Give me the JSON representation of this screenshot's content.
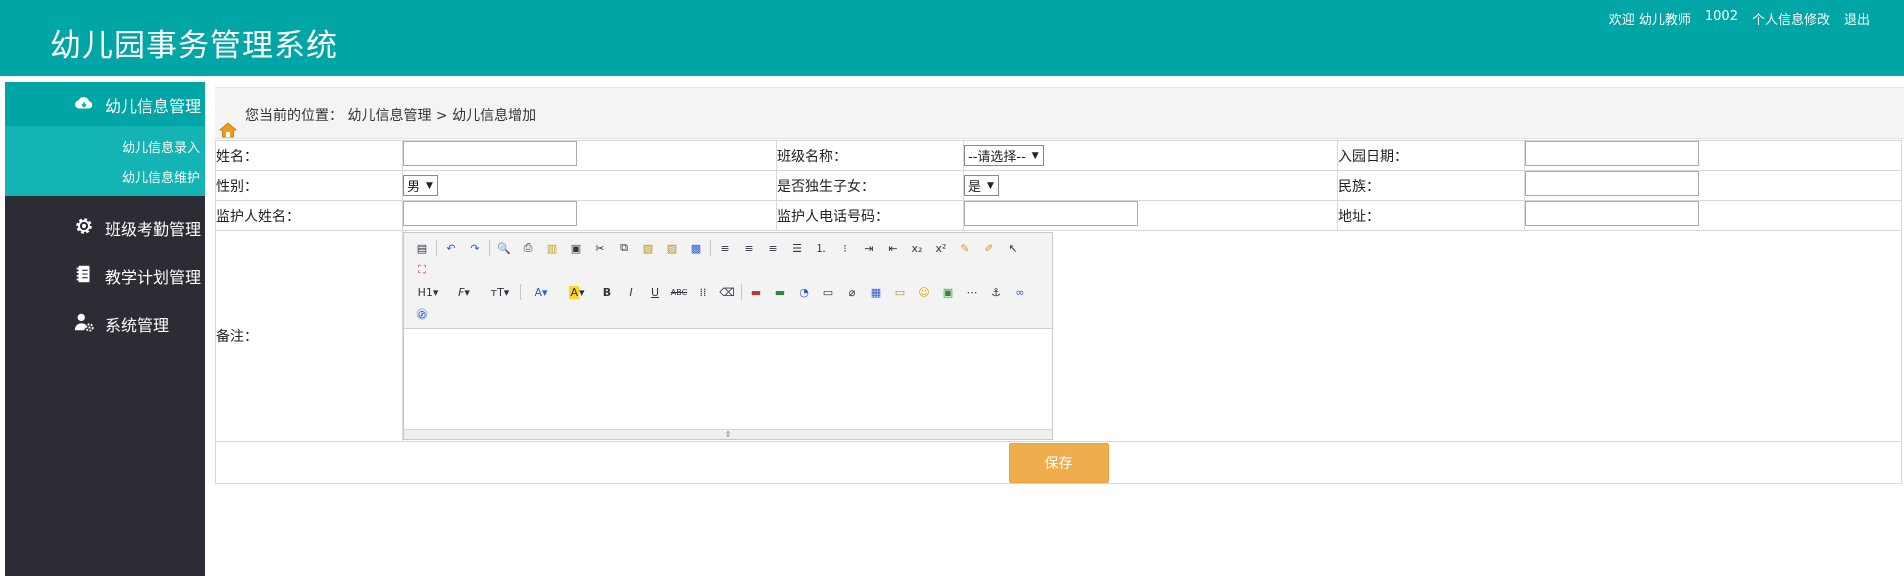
{
  "app": {
    "title": "幼儿园事务管理系统"
  },
  "user_bar": {
    "welcome": "欢迎 幼儿教师",
    "user_id": "1002",
    "profile_link": "个人信息修改",
    "logout_link": "退出"
  },
  "sidebar": {
    "active_group": {
      "label": "幼儿信息管理",
      "icon": "cloud-icon",
      "items": [
        {
          "label": "幼儿信息录入"
        },
        {
          "label": "幼儿信息维护"
        }
      ]
    },
    "groups": [
      {
        "label": "班级考勤管理",
        "icon": "gear-icon"
      },
      {
        "label": "教学计划管理",
        "icon": "notebook-icon"
      },
      {
        "label": "系统管理",
        "icon": "user-gear-icon"
      }
    ]
  },
  "breadcrumb": {
    "text": "您当前的位置：  幼儿信息管理 > 幼儿信息增加"
  },
  "form": {
    "name_label": "姓名：",
    "class_label": "班级名称：",
    "class_value": "--请选择--",
    "enroll_date_label": "入园日期：",
    "gender_label": "性别：",
    "gender_value": "男",
    "only_child_label": "是否独生子女：",
    "only_child_value": "是",
    "ethnicity_label": "民族：",
    "guardian_name_label": "监护人姓名：",
    "guardian_phone_label": "监护人电话号码：",
    "address_label": "地址：",
    "remarks_label": "备注：",
    "save_label": "保存"
  },
  "editor": {
    "heading_btn": "H1",
    "font_btn": "F",
    "fontsize_btn": "тT",
    "bold_btn": "B",
    "italic_btn": "I",
    "underline_btn": "U",
    "strike_btn": "ABC"
  },
  "colors": {
    "header": "#00a5a5",
    "sidebar": "#2c2c34",
    "submenu": "#14b4b4",
    "save": "#f0ad4e"
  }
}
